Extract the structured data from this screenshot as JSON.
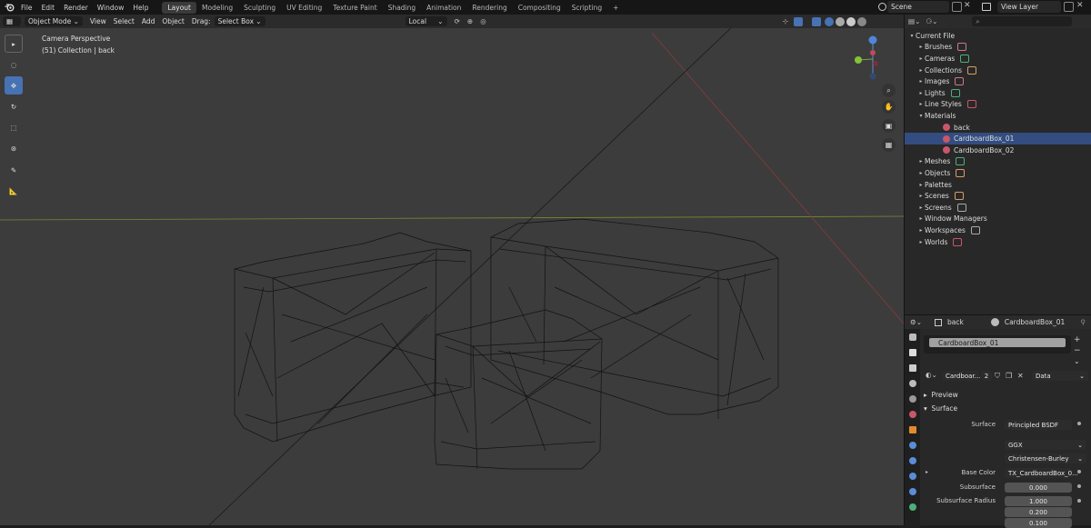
{
  "menu": [
    "File",
    "Edit",
    "Render",
    "Window",
    "Help"
  ],
  "workspaces": [
    "Layout",
    "Modeling",
    "Sculpting",
    "UV Editing",
    "Texture Paint",
    "Shading",
    "Animation",
    "Rendering",
    "Compositing",
    "Scripting"
  ],
  "active_workspace": "Layout",
  "scene_name": "Scene",
  "view_layer_name": "View Layer",
  "viewport_header": {
    "mode": "Object Mode",
    "view": "View",
    "select": "Select",
    "add": "Add",
    "object": "Object",
    "drag_label": "Drag:",
    "drag_value": "Select Box",
    "orientation": "Local"
  },
  "viewport_info": {
    "line1": "Camera Perspective",
    "line2": "(51) Collection | back"
  },
  "outliner": {
    "display_mode": "Current File",
    "search_placeholder": "",
    "rows": [
      {
        "label": "Brushes",
        "indent": 1,
        "expand": "▸",
        "icon_color": "#c87a8a"
      },
      {
        "label": "Cameras",
        "indent": 1,
        "expand": "▸",
        "icon_color": "#4caf7a"
      },
      {
        "label": "Collections",
        "indent": 1,
        "expand": "▸",
        "icon_color": "#d4a066"
      },
      {
        "label": "Images",
        "indent": 1,
        "expand": "▸",
        "icon_color": "#c87a8a"
      },
      {
        "label": "Lights",
        "indent": 1,
        "expand": "▸",
        "icon_color": "#4caf7a"
      },
      {
        "label": "Line Styles",
        "indent": 1,
        "expand": "▸",
        "icon_color": "#c8576a"
      },
      {
        "label": "Materials",
        "indent": 1,
        "expand": "▾",
        "icon_color": ""
      },
      {
        "label": "back",
        "indent": 2,
        "expand": "",
        "icon_color": "#c8576a"
      },
      {
        "label": "CardboardBox_01",
        "indent": 2,
        "expand": "",
        "icon_color": "#c8576a",
        "selected": true
      },
      {
        "label": "CardboardBox_02",
        "indent": 2,
        "expand": "",
        "icon_color": "#c8576a"
      },
      {
        "label": "Meshes",
        "indent": 1,
        "expand": "▸",
        "icon_color": "#4caf7a"
      },
      {
        "label": "Objects",
        "indent": 1,
        "expand": "▸",
        "icon_color": "#d4a066"
      },
      {
        "label": "Palettes",
        "indent": 1,
        "expand": "▸",
        "icon_color": ""
      },
      {
        "label": "Scenes",
        "indent": 1,
        "expand": "▸",
        "icon_color": "#d4a066"
      },
      {
        "label": "Screens",
        "indent": 1,
        "expand": "▸",
        "icon_color": "#aaaaaa"
      },
      {
        "label": "Window Managers",
        "indent": 1,
        "expand": "▸",
        "icon_color": ""
      },
      {
        "label": "Workspaces",
        "indent": 1,
        "expand": "▸",
        "icon_color": "#aaaaaa"
      },
      {
        "label": "Worlds",
        "indent": 1,
        "expand": "▸",
        "icon_color": "#c8576a"
      }
    ]
  },
  "properties": {
    "object_name": "back",
    "material_name": "CardboardBox_01",
    "slot_item": "CardboardBox_01",
    "material_field": "Cardboar...",
    "user_count": "2",
    "link_mode": "Data",
    "preview_label": "Preview",
    "surface_label": "Surface",
    "surface_field_label": "Surface",
    "surface_value": "Principled BSDF",
    "distribution": "GGX",
    "subsurface_method": "Christensen-Burley",
    "base_color_label": "Base Color",
    "base_color_value": "TX_CardboardBox_0...",
    "subsurface_label": "Subsurface",
    "subsurface_value": "0.000",
    "subsurface_radius_label": "Subsurface Radius",
    "subsurface_radius": [
      "1.000",
      "0.200",
      "0.100"
    ]
  }
}
